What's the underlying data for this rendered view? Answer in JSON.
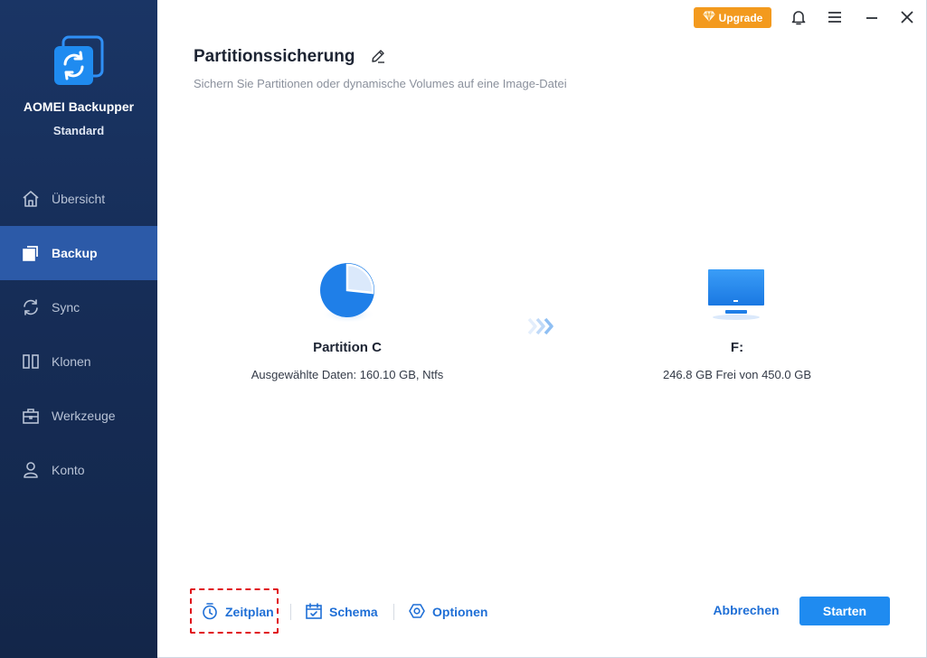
{
  "app": {
    "name": "AOMEI Backupper",
    "edition": "Standard"
  },
  "sidebar": {
    "items": [
      {
        "label": "Übersicht",
        "icon": "home-icon",
        "active": false
      },
      {
        "label": "Backup",
        "icon": "backup-icon",
        "active": true
      },
      {
        "label": "Sync",
        "icon": "sync-icon",
        "active": false
      },
      {
        "label": "Klonen",
        "icon": "clone-icon",
        "active": false
      },
      {
        "label": "Werkzeuge",
        "icon": "toolbox-icon",
        "active": false
      },
      {
        "label": "Konto",
        "icon": "user-icon",
        "active": false
      }
    ]
  },
  "topbar": {
    "upgrade_label": "Upgrade",
    "upgrade_color": "#f39a1e"
  },
  "header": {
    "title": "Partitionssicherung",
    "subtitle": "Sichern Sie Partitionen oder dynamische Volumes auf eine Image-Datei"
  },
  "source": {
    "name": "Partition C",
    "detail": "Ausgewählte Daten: 160.10 GB, Ntfs"
  },
  "destination": {
    "name": "F:",
    "detail": "246.8 GB Frei von 450.0 GB"
  },
  "bottom": {
    "schedule_label": "Zeitplan",
    "scheme_label": "Schema",
    "options_label": "Optionen",
    "cancel_label": "Abbrechen",
    "start_label": "Starten"
  },
  "colors": {
    "accent": "#1f8bf0",
    "link": "#1f6fd6",
    "sidebar": "#162d57",
    "sidebar_active": "#2c5aa8",
    "highlight": "#e0111a"
  }
}
